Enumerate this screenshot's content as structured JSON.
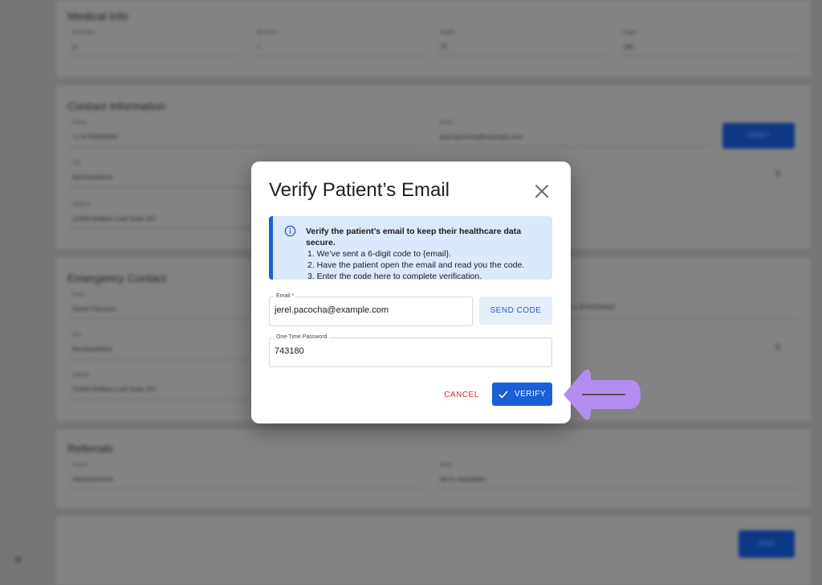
{
  "background": {
    "medical": {
      "title": "Medical Info",
      "fields": [
        {
          "label": "Blood type",
          "value": "O"
        },
        {
          "label": "RH factor",
          "value": "+"
        },
        {
          "label": "Weight",
          "value": "70"
        },
        {
          "label": "Height",
          "value": "180"
        }
      ]
    },
    "contact": {
      "title": "Contact Information",
      "phone_label": "Phone",
      "phone_value": "+1 9743282834",
      "email_label": "Email",
      "email_value": "jerel.pacocha@example.com",
      "verify_label": "VERIFY",
      "city_label": "City",
      "city_value": "Bernhardshire",
      "address_label": "Address",
      "address_value": "11468 Rolfson Loaf Suite 267"
    },
    "emergency": {
      "title": "Emergency Contact",
      "name_label": "Name",
      "name_value": "Sarah Pacocha",
      "phone_value": "+1 9743282834",
      "city_label": "City",
      "city_value": "Bernhardshire",
      "address_label": "Address",
      "address_value": "11468 Rolfson Loaf Suite 267"
    },
    "referrals": {
      "title": "Referrals",
      "source_label": "Source",
      "source_value": "Advertisement",
      "notes_label": "Notes",
      "notes_value": "Ad in newsletter"
    },
    "save_label": "SAVE"
  },
  "dialog": {
    "title": "Verify Patient’s Email",
    "info": {
      "heading": "Verify the patient’s email to keep their healthcare data secure.",
      "steps": [
        "1. We’ve sent a 6-digit code to {email}.",
        "2. Have the patient open the email and read you the code.",
        "3. Enter the code here to complete verification."
      ]
    },
    "email": {
      "label": "Email *",
      "value": "jerel.pacocha@example.com"
    },
    "send_code_label": "SEND CODE",
    "otp": {
      "label": "One-Time Password",
      "value": "743180"
    },
    "cancel_label": "CANCEL",
    "verify_label": "VERIFY"
  },
  "colors": {
    "primary": "#1a5fd8",
    "cancel": "#d32f2f",
    "info_bg": "#dce8fb",
    "arrow": "#b48df0"
  }
}
